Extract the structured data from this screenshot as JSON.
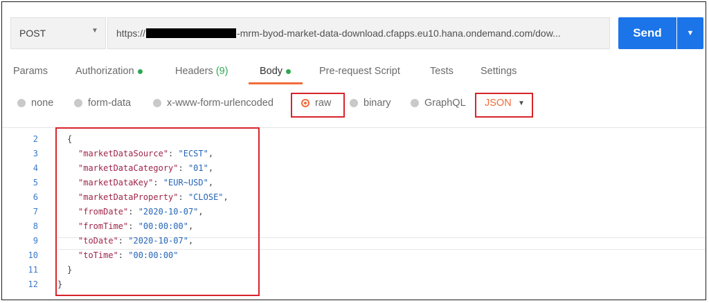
{
  "request": {
    "method": "POST",
    "url_prefix": "https://",
    "url_suffix": "-mrm-byod-market-data-download.cfapps.eu10.hana.ondemand.com/dow...",
    "send_label": "Send"
  },
  "tabs": [
    {
      "label": "Params"
    },
    {
      "label": "Authorization"
    },
    {
      "label": "Headers",
      "count": "(9)"
    },
    {
      "label": "Body"
    },
    {
      "label": "Pre-request Script"
    },
    {
      "label": "Tests"
    },
    {
      "label": "Settings"
    }
  ],
  "body_types": [
    {
      "label": "none"
    },
    {
      "label": "form-data"
    },
    {
      "label": "x-www-form-urlencoded"
    },
    {
      "label": "raw"
    },
    {
      "label": "binary"
    },
    {
      "label": "GraphQL"
    }
  ],
  "format": "JSON",
  "editor": {
    "line_numbers": [
      "2",
      "3",
      "4",
      "5",
      "6",
      "7",
      "8",
      "9",
      "10",
      "11",
      "12"
    ],
    "open_brace": "{",
    "close_brace": "}",
    "fields": [
      {
        "key": "\"marketDataSource\"",
        "value": "\"ECST\""
      },
      {
        "key": "\"marketDataCategory\"",
        "value": "\"01\""
      },
      {
        "key": "\"marketDataKey\"",
        "value": "\"EUR~USD\""
      },
      {
        "key": "\"marketDataProperty\"",
        "value": "\"CLOSE\""
      },
      {
        "key": "\"fromDate\"",
        "value": "\"2020-10-07\""
      },
      {
        "key": "\"fromTime\"",
        "value": "\"00:00:00\""
      },
      {
        "key": "\"toDate\"",
        "value": "\"2020-10-07\""
      },
      {
        "key": "\"toTime\"",
        "value": "\"00:00:00\""
      }
    ],
    "inner_brace": "}",
    "outer_brace": "}"
  },
  "colors": {
    "accent": "#f26b3a",
    "send_blue": "#1b74e8",
    "annotation_red": "#d8232a",
    "status_green": "#2fa84f"
  }
}
